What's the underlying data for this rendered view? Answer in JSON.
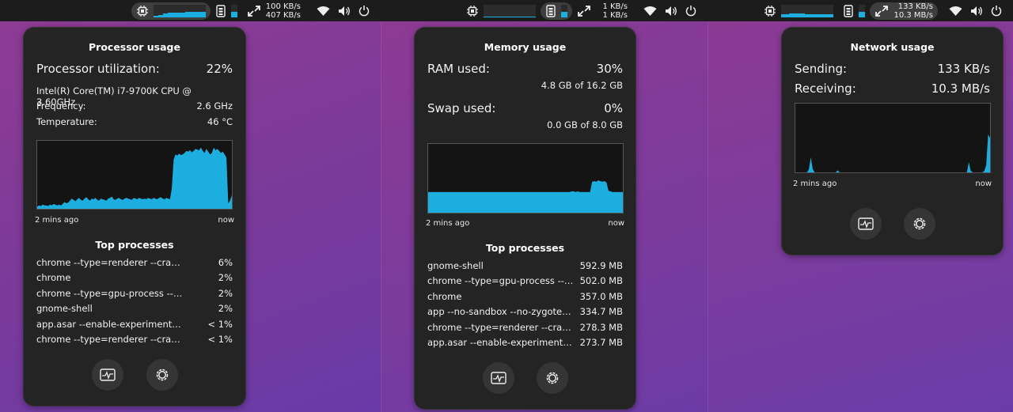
{
  "colors": {
    "accent": "#1daee0",
    "panel": "#242424",
    "topbar": "#1c1c1c"
  },
  "topbar": {
    "left": {
      "net_up": "100 KB/s",
      "net_down": "407 KB/s"
    },
    "middle": {
      "net_up": "1 KB/s",
      "net_down": "1 KB/s"
    },
    "right": {
      "net_up": "133 KB/s",
      "net_down": "10.3 MB/s"
    },
    "icons": [
      "cpu-icon",
      "memory-icon",
      "network-icon",
      "wifi-icon",
      "volume-icon",
      "power-icon"
    ]
  },
  "processor": {
    "title": "Processor usage",
    "utilization_label": "Processor utilization:",
    "utilization_value": "22%",
    "cpu_name": "Intel(R) Core(TM) i7-9700K CPU @ 3.60GHz",
    "frequency_label": "Frequency:",
    "frequency_value": "2.6 GHz",
    "temperature_label": "Temperature:",
    "temperature_value": "46 °C",
    "time_start": "2 mins ago",
    "time_end": "now",
    "graph": [
      0.03,
      0.05,
      0.04,
      0.06,
      0.05,
      0.05,
      0.04,
      0.06,
      0.05,
      0.07,
      0.06,
      0.05,
      0.06,
      0.05,
      0.07,
      0.1,
      0.08,
      0.09,
      0.12,
      0.15,
      0.13,
      0.11,
      0.14,
      0.16,
      0.13,
      0.12,
      0.15,
      0.17,
      0.14,
      0.12,
      0.15,
      0.14,
      0.16,
      0.13,
      0.12,
      0.15,
      0.14,
      0.13,
      0.12,
      0.15,
      0.16,
      0.18,
      0.14,
      0.13,
      0.15,
      0.16,
      0.14,
      0.13,
      0.15,
      0.16,
      0.15,
      0.14,
      0.13,
      0.16,
      0.15,
      0.14,
      0.16,
      0.15,
      0.14,
      0.15,
      0.14,
      0.16,
      0.15,
      0.14,
      0.16,
      0.15,
      0.14,
      0.16,
      0.17,
      0.15,
      0.14,
      0.16,
      0.15,
      0.14,
      0.3,
      0.72,
      0.8,
      0.78,
      0.81,
      0.79,
      0.8,
      0.82,
      0.85,
      0.84,
      0.86,
      0.83,
      0.85,
      0.88,
      0.87,
      0.86,
      0.9,
      0.85,
      0.82,
      0.88,
      0.84,
      0.8,
      0.82,
      0.9,
      0.86,
      0.88,
      0.85,
      0.82,
      0.84,
      0.8,
      0.75,
      0.08,
      0.12,
      0.2
    ],
    "top_processes_title": "Top processes",
    "processes": [
      {
        "name": "chrome --type=renderer --crashpad-handler",
        "value": "6%"
      },
      {
        "name": "chrome",
        "value": "2%"
      },
      {
        "name": "chrome --type=gpu-process --crashpad",
        "value": "2%"
      },
      {
        "name": "gnome-shell",
        "value": "2%"
      },
      {
        "name": "app.asar --enable-experimental-web",
        "value": "< 1%"
      },
      {
        "name": "chrome --type=renderer --crashpad-handler",
        "value": "< 1%"
      }
    ]
  },
  "memory": {
    "title": "Memory usage",
    "ram_label": "RAM used:",
    "ram_value": "30%",
    "ram_detail": "4.8 GB of 16.2 GB",
    "swap_label": "Swap used:",
    "swap_value": "0%",
    "swap_detail": "0.0 GB of 8.0 GB",
    "time_start": "2 mins ago",
    "time_end": "now",
    "graph": [
      0.3,
      0.3,
      0.3,
      0.3,
      0.3,
      0.3,
      0.3,
      0.3,
      0.3,
      0.3,
      0.3,
      0.3,
      0.3,
      0.3,
      0.3,
      0.3,
      0.3,
      0.3,
      0.3,
      0.3,
      0.3,
      0.3,
      0.3,
      0.3,
      0.3,
      0.3,
      0.3,
      0.3,
      0.3,
      0.3,
      0.3,
      0.3,
      0.3,
      0.3,
      0.3,
      0.3,
      0.3,
      0.3,
      0.3,
      0.3,
      0.3,
      0.3,
      0.3,
      0.3,
      0.3,
      0.3,
      0.3,
      0.3,
      0.3,
      0.3,
      0.3,
      0.3,
      0.3,
      0.3,
      0.3,
      0.3,
      0.3,
      0.3,
      0.3,
      0.3,
      0.3,
      0.3,
      0.3,
      0.3,
      0.3,
      0.3,
      0.3,
      0.3,
      0.3,
      0.3,
      0.31,
      0.31,
      0.3,
      0.31,
      0.3,
      0.3,
      0.3,
      0.3,
      0.3,
      0.3,
      0.45,
      0.46,
      0.45,
      0.47,
      0.46,
      0.45,
      0.46,
      0.44,
      0.32,
      0.31,
      0.3,
      0.3,
      0.3,
      0.3,
      0.3,
      0.3
    ],
    "top_processes_title": "Top processes",
    "processes": [
      {
        "name": "gnome-shell",
        "value": "592.9 MB"
      },
      {
        "name": "chrome --type=gpu-process --crashpad",
        "value": "502.0 MB"
      },
      {
        "name": "chrome",
        "value": "357.0 MB"
      },
      {
        "name": "app --no-sandbox --no-zygote --enable",
        "value": "334.7 MB"
      },
      {
        "name": "chrome --type=renderer --crashpad",
        "value": "278.3 MB"
      },
      {
        "name": "app.asar --enable-experimental-web",
        "value": "273.7 MB"
      }
    ]
  },
  "network": {
    "title": "Network usage",
    "sending_label": "Sending:",
    "sending_value": "133 KB/s",
    "receiving_label": "Receiving:",
    "receiving_value": "10.3 MB/s",
    "time_start": "2 mins ago",
    "time_end": "now",
    "graph": [
      0,
      0,
      0,
      0,
      0,
      0,
      0,
      0.04,
      0.22,
      0.05,
      0,
      0,
      0,
      0,
      0,
      0,
      0,
      0,
      0,
      0,
      0,
      0,
      0.03,
      0,
      0,
      0,
      0,
      0,
      0,
      0,
      0,
      0,
      0,
      0,
      0,
      0,
      0,
      0,
      0,
      0,
      0,
      0,
      0,
      0,
      0,
      0,
      0,
      0,
      0,
      0,
      0,
      0,
      0,
      0,
      0,
      0,
      0,
      0,
      0,
      0,
      0,
      0,
      0,
      0,
      0,
      0,
      0,
      0,
      0,
      0,
      0,
      0,
      0,
      0,
      0,
      0,
      0,
      0,
      0,
      0,
      0,
      0,
      0,
      0,
      0,
      0,
      0,
      0,
      0,
      0,
      0.15,
      0.02,
      0,
      0,
      0,
      0,
      0,
      0,
      0.02,
      0.1,
      0.55,
      0.5
    ]
  }
}
